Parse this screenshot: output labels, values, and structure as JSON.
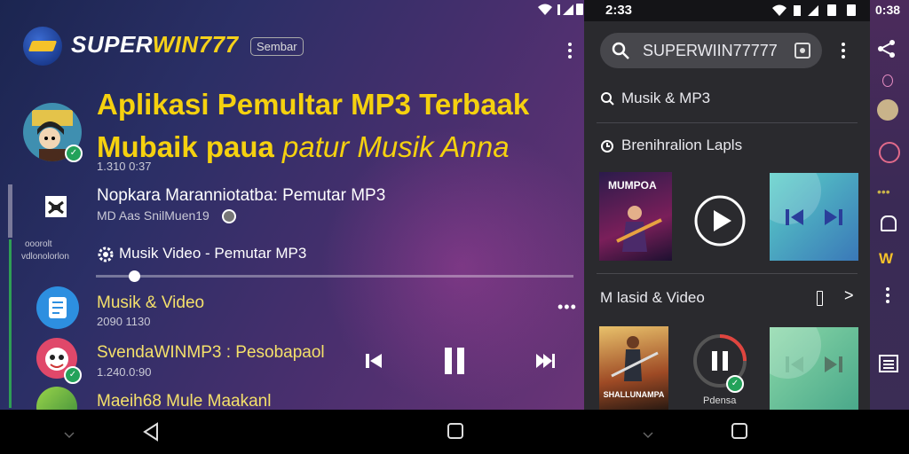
{
  "left": {
    "brand_main": "SUPER",
    "brand_accent": "WIN777",
    "chip": "Sembar",
    "headline_line1": "Aplikasi Pemultar MP3 Terbaak",
    "headline_line2a": "Mubaik paua ",
    "headline_line2b": "patur Musik Anna",
    "headline_sub": "1.310 0:37",
    "item1_title": "Nopkara Maranniotatba: Pemutar MP3",
    "item1_sub": "MD Aas SnilMuen19",
    "side_text_1": "ooorolt",
    "side_text_2": "vdlonolorlon",
    "item2_title": "Musik Video - Pemutar MP3",
    "progress_fraction": 0.08,
    "item3_title": "Musik & Video",
    "item3_sub": "2090 1130",
    "item4_title": "SvendaWINMP3 : Pesobapaol",
    "item4_sub": "1.240.0:90",
    "item5_title": "Maeih68 Mule Maakanl",
    "colors": {
      "accent_yellow": "#f5d10f",
      "check_green": "#23a25a"
    }
  },
  "status": {
    "left_time": "2:33",
    "right_time": "0:38"
  },
  "right": {
    "search_value": "SUPERWIIN77777",
    "row1": "Musik & MP3",
    "row2": "Brenihralion Lapls",
    "album1_title": "MUMPOA",
    "section_title": "M lasid & Video",
    "album2_title": "SHALLUNAMPA",
    "album3_caption": "Pdensa"
  },
  "icons": [
    "search-icon",
    "share-icon",
    "play-icon",
    "pause-icon",
    "previous-icon",
    "next-icon",
    "more-vert-icon",
    "back-icon",
    "home-icon",
    "menu-icon"
  ]
}
